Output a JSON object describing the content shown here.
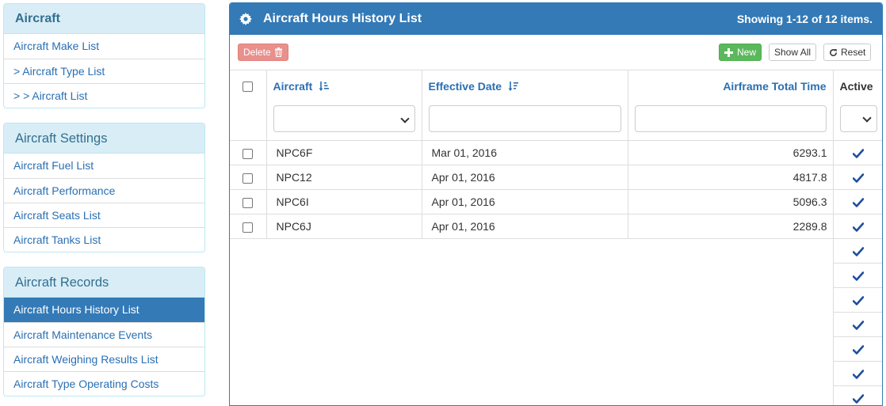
{
  "sidebar": {
    "groups": [
      {
        "title": "Aircraft",
        "items": [
          "Aircraft Make List",
          "> Aircraft Type List",
          "> > Aircraft List"
        ]
      },
      {
        "title": "Aircraft Settings",
        "items": [
          "Aircraft Fuel List",
          "Aircraft Performance",
          "Aircraft Seats List",
          "Aircraft Tanks List"
        ]
      },
      {
        "title": "Aircraft Records",
        "active_index": 0,
        "items": [
          "Aircraft Hours History List",
          "Aircraft Maintenance Events",
          "Aircraft Weighing Results List",
          "Aircraft Type Operating Costs"
        ]
      }
    ]
  },
  "main": {
    "title": "Aircraft Hours History List",
    "showing": "Showing 1-12 of 12 items.",
    "header_icon": "gear-icon",
    "toolbar": {
      "delete_label": "Delete",
      "new_label": "New",
      "show_all_label": "Show All",
      "reset_label": "Reset"
    },
    "columns": {
      "aircraft": "Aircraft",
      "effective_date": "Effective Date",
      "airframe_total_time": "Airframe Total Time",
      "active": "Active"
    },
    "rows": [
      {
        "aircraft": "NPC6F",
        "effective_date": "Mar 01, 2016",
        "airframe_total_time": "6293.1",
        "active": true
      },
      {
        "aircraft": "NPC12",
        "effective_date": "Apr 01, 2016",
        "airframe_total_time": "4817.8",
        "active": true
      },
      {
        "aircraft": "NPC6I",
        "effective_date": "Apr 01, 2016",
        "airframe_total_time": "5096.3",
        "active": true
      },
      {
        "aircraft": "NPC6J",
        "effective_date": "Apr 01, 2016",
        "airframe_total_time": "2289.8",
        "active": true
      }
    ],
    "extra_active_rows": 7
  },
  "colors": {
    "primary": "#337ab7",
    "heading_bg": "#d9edf7",
    "link": "#2a6fb3",
    "success": "#5cb85c",
    "danger": "#e8908c"
  }
}
